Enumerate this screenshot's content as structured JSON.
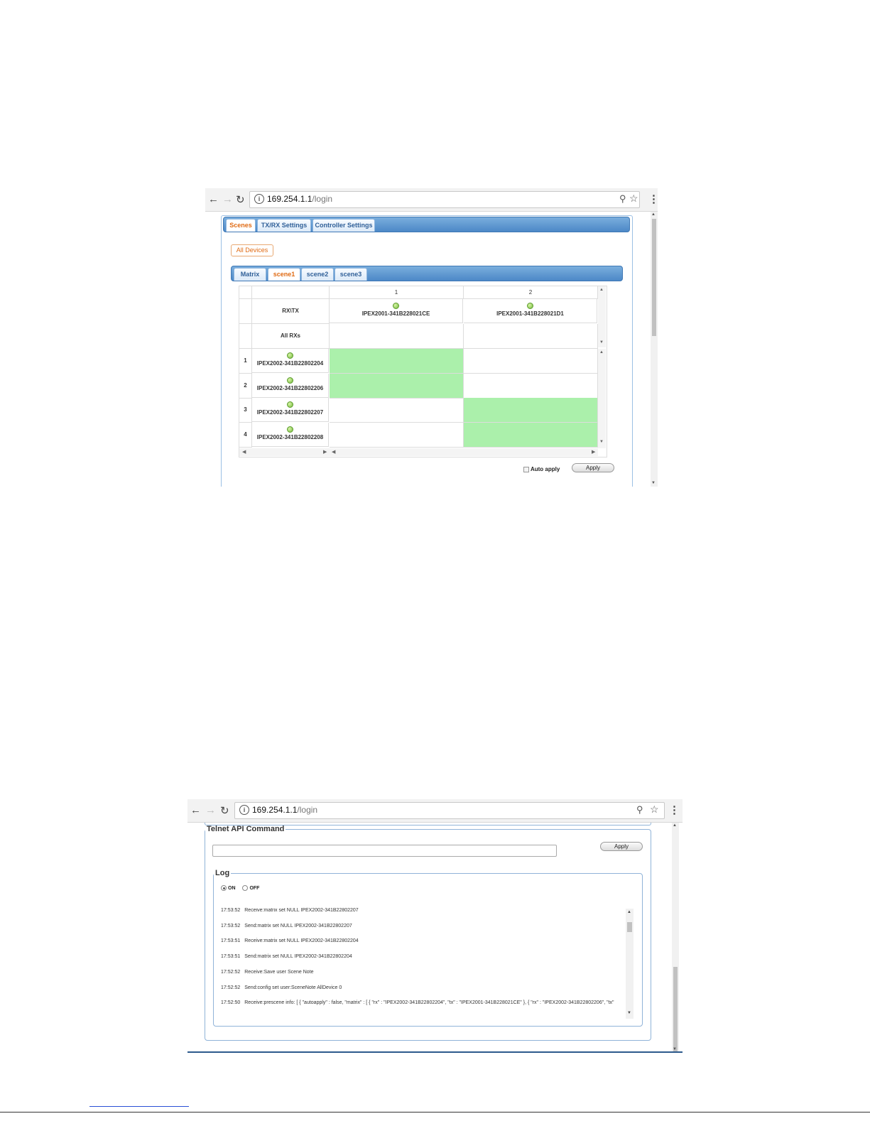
{
  "browser": {
    "url_host": "169.254.1.1",
    "url_path": "/login"
  },
  "screen1": {
    "main_tabs": [
      "Scenes",
      "TX/RX Settings",
      "Controller Settings"
    ],
    "all_devices_button": "All Devices",
    "scene_tabs": [
      "Matrix",
      "scene1",
      "scene2",
      "scene3"
    ],
    "active_scene_tab": "scene1",
    "matrix": {
      "column_numbers": [
        "1",
        "2"
      ],
      "corner_label": "RX\\TX",
      "tx_devices": [
        "IPEX2001-341B228021CE",
        "IPEX2001-341B228021D1"
      ],
      "all_rxs_label": "All RXs",
      "rows": [
        {
          "num": "1",
          "rx": "IPEX2002-341B22802204",
          "active_col": 0
        },
        {
          "num": "2",
          "rx": "IPEX2002-341B22802206",
          "active_col": 0
        },
        {
          "num": "3",
          "rx": "IPEX2002-341B22802207",
          "active_col": 1
        },
        {
          "num": "4",
          "rx": "IPEX2002-341B22802208",
          "active_col": 1
        }
      ]
    },
    "auto_apply_label": "Auto apply",
    "apply_button": "Apply",
    "colors": {
      "active_cell": "#abf0ab",
      "active_tab_text": "#e06b14",
      "tab_strip": "#4c88c7"
    }
  },
  "screen2": {
    "telnet_legend": "Telnet API Command",
    "command_value": "",
    "apply_button": "Apply",
    "log_legend": "Log",
    "log_on_label": "ON",
    "log_off_label": "OFF",
    "log_state": "ON",
    "log_lines": [
      {
        "time": "17:53:52",
        "text": "Receive:matrix set NULL IPEX2002-341B22802207"
      },
      {
        "time": "17:53:52",
        "text": "Send:matrix set NULL IPEX2002-341B22802207"
      },
      {
        "time": "17:53:51",
        "text": "Receive:matrix set NULL IPEX2002-341B22802204"
      },
      {
        "time": "17:53:51",
        "text": "Send:matrix set NULL IPEX2002-341B22802204"
      },
      {
        "time": "17:52:52",
        "text": "Receive:Save user Scene Note"
      },
      {
        "time": "17:52:52",
        "text": "Send:config set user:SceneNote AllDevice 0"
      },
      {
        "time": "17:52:50",
        "text": "Receive:prescene info: [ { \"autoapply\" : false, \"matrix\" : [ { \"rx\" : \"IPEX2002-341B22802204\", \"tx\" : \"IPEX2001-341B228021CE\" }, { \"rx\" : \"IPEX2002-341B22802206\", \"tx\""
      }
    ]
  }
}
